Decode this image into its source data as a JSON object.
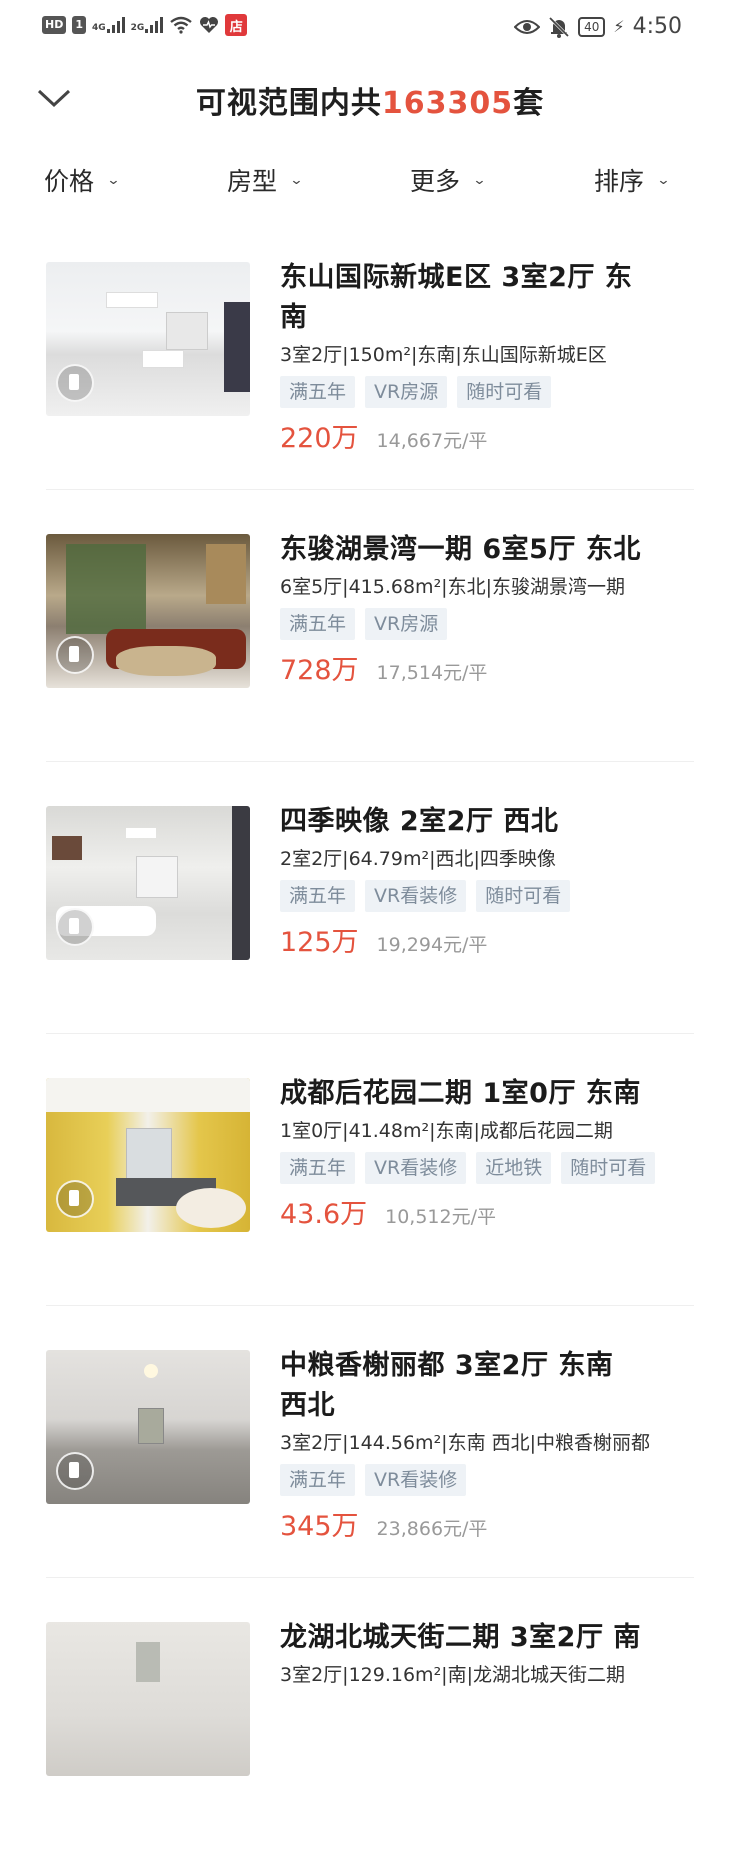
{
  "status_bar": {
    "hd_label": "HD",
    "sim_label": "1",
    "net1": "4G",
    "net2": "2G",
    "store_badge": "店",
    "battery": "40",
    "time": "4:50"
  },
  "header": {
    "title_prefix": "可视范围内共",
    "count": "163305",
    "title_suffix": "套"
  },
  "filters": [
    {
      "label": "价格"
    },
    {
      "label": "房型"
    },
    {
      "label": "更多"
    },
    {
      "label": "排序"
    }
  ],
  "listings": [
    {
      "name_line1": "东山国际新城E区 3室2厅 东",
      "name_line2": "南",
      "desc": "3室2厅|150m²|东南|东山国际新城E区",
      "tags": [
        "满五年",
        "VR房源",
        "随时可看"
      ],
      "price": "220万",
      "unit_price": "14,667元/平"
    },
    {
      "name_line1": "东骏湖景湾一期 6室5厅 东北",
      "name_line2": "",
      "desc": "6室5厅|415.68m²|东北|东骏湖景湾一期",
      "tags": [
        "满五年",
        "VR房源"
      ],
      "price": "728万",
      "unit_price": "17,514元/平"
    },
    {
      "name_line1": "四季映像 2室2厅 西北",
      "name_line2": "",
      "desc": "2室2厅|64.79m²|西北|四季映像",
      "tags": [
        "满五年",
        "VR看装修",
        "随时可看"
      ],
      "price": "125万",
      "unit_price": "19,294元/平"
    },
    {
      "name_line1": "成都后花园二期 1室0厅 东南",
      "name_line2": "",
      "desc": "1室0厅|41.48m²|东南|成都后花园二期",
      "tags": [
        "满五年",
        "VR看装修",
        "近地铁",
        "随时可看"
      ],
      "price": "43.6万",
      "unit_price": "10,512元/平"
    },
    {
      "name_line1": "中粮香榭丽都 3室2厅 东南",
      "name_line2": "西北",
      "desc": "3室2厅|144.56m²|东南 西北|中粮香榭丽都",
      "tags": [
        "满五年",
        "VR看装修"
      ],
      "price": "345万",
      "unit_price": "23,866元/平"
    },
    {
      "name_line1": "龙湖北城天街二期 3室2厅 南",
      "name_line2": "",
      "desc": "3室2厅|129.16m²|南|龙湖北城天街二期",
      "tags": [],
      "price": "",
      "unit_price": ""
    }
  ]
}
